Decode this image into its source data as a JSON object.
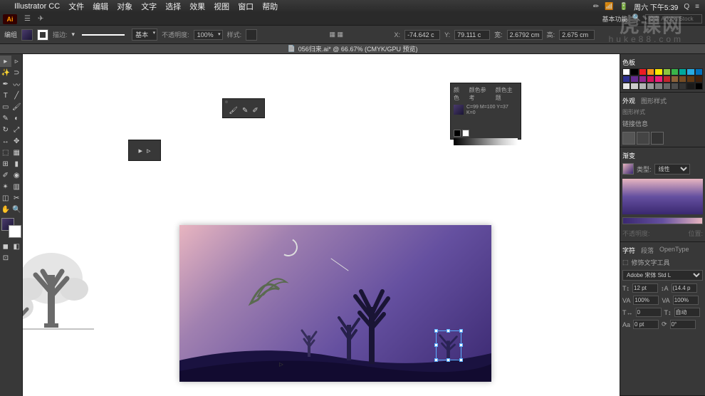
{
  "menubar": {
    "apple": "",
    "app": "Illustrator CC",
    "items": [
      "文件",
      "编辑",
      "对象",
      "文字",
      "选择",
      "效果",
      "视图",
      "窗口",
      "帮助"
    ],
    "right": {
      "clock": "周六 下午5:39",
      "icons": [
        "⚙",
        "📶",
        "🔋",
        "Q",
        "≡"
      ]
    }
  },
  "app_header": {
    "workspace": "基本功能",
    "search_placeholder": "搜索 Adobe Stock"
  },
  "control_bar": {
    "label_opacity": "不透明度:",
    "opacity": "100%",
    "label_style": "样式:",
    "label_stroke": "描边:",
    "stroke_pt": "基本",
    "x_val": "-74.642 c",
    "y_val": "79.111 c",
    "w_val": "2.6792 cm",
    "h_val": "2.675 cm"
  },
  "doc_tab": "056归来.ai* @ 66.67% (CMYK/GPU 预览)",
  "toolbox": [
    "▸",
    "▹",
    "✎",
    "✒",
    "T",
    "╱",
    "▭",
    "✶",
    "◔",
    "⊞",
    "✂",
    "◐",
    "↻",
    "▦",
    "↔",
    "✥",
    "⬚",
    "✴",
    "◉",
    "〰",
    "◫",
    "⊡",
    "✋",
    "🔍"
  ],
  "right": {
    "color_tabs": [
      "颜色",
      "颜色参考",
      "颜色主题"
    ],
    "color_value": "C=99 M=100 Y=37 K=0",
    "panel_title_appearance": "外观",
    "panel_title_graphic": "图形样式",
    "panel_title_link": "链接信息",
    "swatches_tab": "色板",
    "gradient_tab": "渐变",
    "gradient_type": "类型:",
    "char_tab": "字符",
    "para_tab": "段落",
    "opentype_tab": "OpenType",
    "touch_type": "修饰文字工具",
    "font": "Adobe 宋体 Std L",
    "font_size": "12 pt",
    "leading": "(14.4 p",
    "tracking": "0",
    "kerning": "自动",
    "hscale": "100%",
    "vscale": "100%",
    "baseline": "0 pt",
    "rotate": "0°"
  },
  "watermark": {
    "main": "虎课网",
    "sub": "huke88.com"
  },
  "colors": {
    "bg": "#2a2a2a",
    "panel": "#383838",
    "sky_start": "#e8b5c0",
    "sky_mid": "#6550a0",
    "sky_end": "#3a2870"
  }
}
